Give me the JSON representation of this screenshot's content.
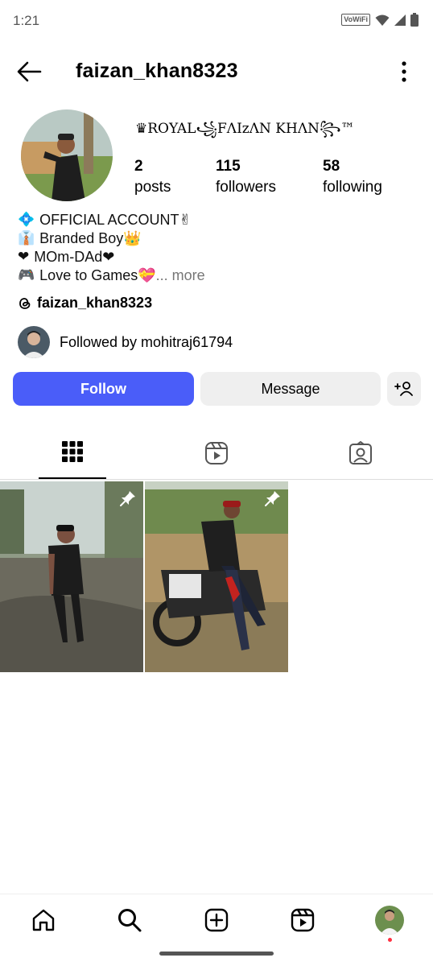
{
  "status_bar": {
    "time": "1:21",
    "network_badge": "VoWiFi",
    "icons": [
      "wifi-icon",
      "signal-icon",
      "battery-icon"
    ]
  },
  "header": {
    "username": "faizan_khan8323",
    "back_icon": "back-arrow-icon",
    "menu_icon": "more-vertical-icon"
  },
  "profile": {
    "display_name": "♛ROYAL꧁FΛIzΛN KHΛN꧂™",
    "stats": [
      {
        "value": "2",
        "label": "posts"
      },
      {
        "value": "115",
        "label": "followers"
      },
      {
        "value": "58",
        "label": "following"
      }
    ],
    "bio": [
      {
        "emoji": "💠",
        "text": "OFFICIAL ACCOUNT✌"
      },
      {
        "emoji": "👔",
        "text": "Branded Boy👑"
      },
      {
        "emoji": "❤",
        "text": "MOm-DAd❤"
      },
      {
        "emoji": "🎮",
        "text": "Love to Games💝"
      }
    ],
    "more_label": "... more",
    "threads_handle": "faizan_khan8323",
    "followed_by": "Followed by mohitraj61794"
  },
  "actions": {
    "follow_label": "Follow",
    "message_label": "Message"
  },
  "tabs": [
    "grid-icon",
    "reels-icon",
    "tagged-icon"
  ],
  "posts": [
    {
      "pinned": true
    },
    {
      "pinned": true
    }
  ],
  "bottom_nav": [
    "home-icon",
    "search-icon",
    "create-icon",
    "reels-icon",
    "profile-avatar"
  ],
  "colors": {
    "accent": "#4a5df9",
    "secondary_button": "#efefef",
    "notification_dot": "#ff3040"
  }
}
